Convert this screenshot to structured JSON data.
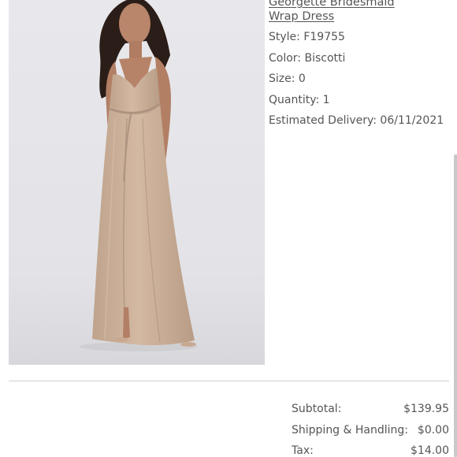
{
  "product": {
    "image_icon": "dress-photo",
    "name_line1": "Georgette Bridesmaid",
    "name_line2": "Wrap Dress",
    "style": "Style: F19755",
    "color": "Color: Biscotti",
    "size": "Size: 0",
    "quantity": "Quantity: 1",
    "estimated_delivery": "Estimated Delivery: 06/11/2021"
  },
  "summary": {
    "subtotal_label": "Subtotal:",
    "subtotal_value": "$139.95",
    "shipping_label": "Shipping & Handling:",
    "shipping_value": "$0.00",
    "tax_label": "Tax:",
    "tax_value": "$14.00"
  },
  "colors": {
    "text": "#555555",
    "dress": "#c9ad96",
    "background_photo": "#e6e6ea"
  }
}
